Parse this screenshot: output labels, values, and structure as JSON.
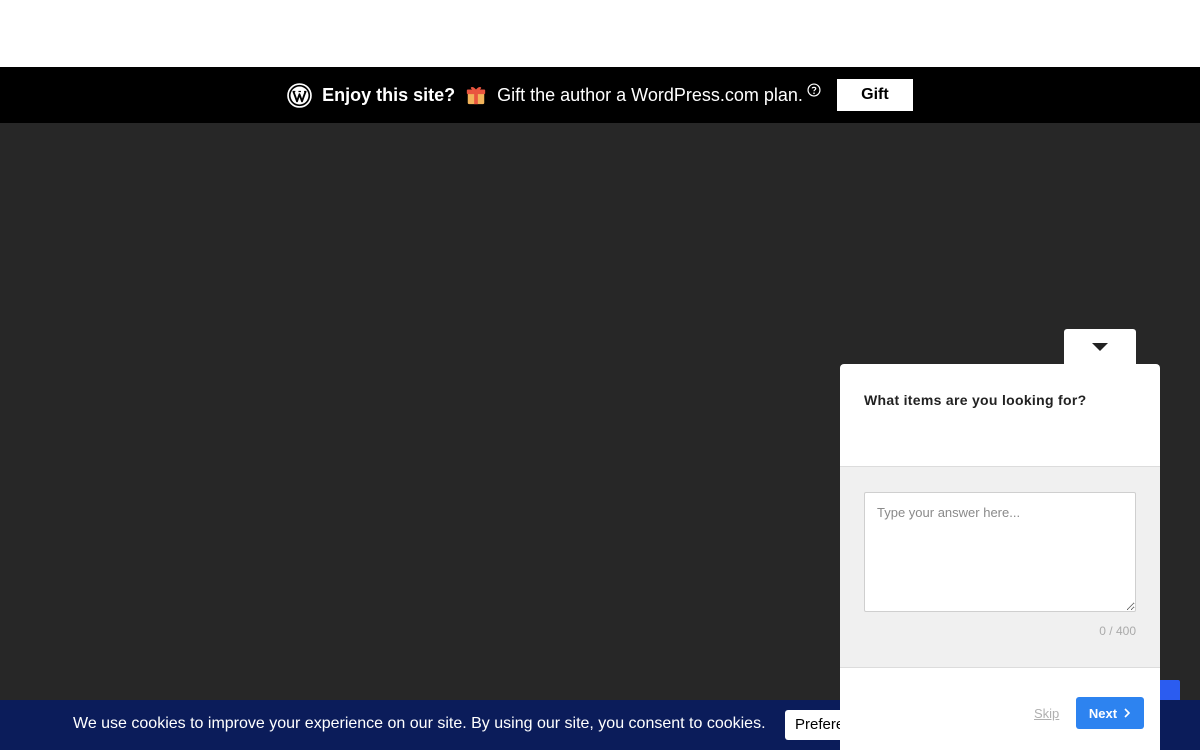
{
  "gift_banner": {
    "enjoy_text": "Enjoy this site?",
    "message": "Gift the author a WordPress.com plan.",
    "button_label": "Gift",
    "icons": [
      "wordpress-logo-icon",
      "gift-icon",
      "help-icon"
    ]
  },
  "survey": {
    "question": "What items are you looking for?",
    "answer_placeholder": "Type your answer here...",
    "answer_value": "",
    "counter": "0 / 400",
    "skip_label": "Skip",
    "next_label": "Next",
    "accent_color": "#2d83f0",
    "icons": [
      "chevron-down-icon",
      "chevron-right-icon"
    ]
  },
  "cookie_banner": {
    "message": "We use cookies to improve your experience on our site. By using our site, you consent to cookies.",
    "preferences_label": "Prefere",
    "background_color": "#0b1c5a"
  }
}
